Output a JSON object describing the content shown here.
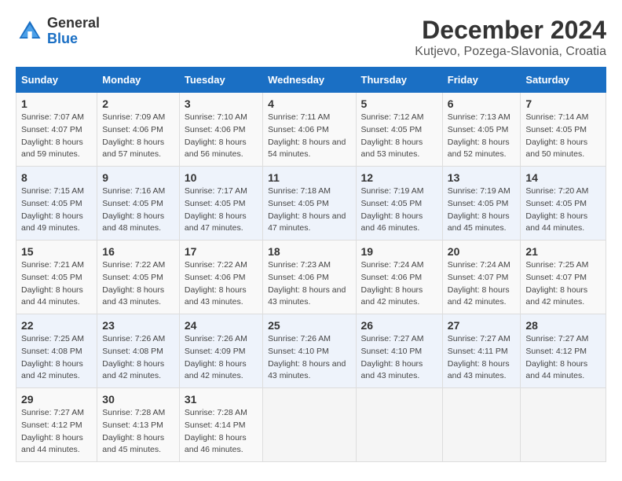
{
  "header": {
    "logo_general": "General",
    "logo_blue": "Blue",
    "month_title": "December 2024",
    "location": "Kutjevo, Pozega-Slavonia, Croatia"
  },
  "days_of_week": [
    "Sunday",
    "Monday",
    "Tuesday",
    "Wednesday",
    "Thursday",
    "Friday",
    "Saturday"
  ],
  "weeks": [
    [
      {
        "day": 1,
        "sunrise": "7:07 AM",
        "sunset": "4:07 PM",
        "daylight": "8 hours and 59 minutes."
      },
      {
        "day": 2,
        "sunrise": "7:09 AM",
        "sunset": "4:06 PM",
        "daylight": "8 hours and 57 minutes."
      },
      {
        "day": 3,
        "sunrise": "7:10 AM",
        "sunset": "4:06 PM",
        "daylight": "8 hours and 56 minutes."
      },
      {
        "day": 4,
        "sunrise": "7:11 AM",
        "sunset": "4:06 PM",
        "daylight": "8 hours and 54 minutes."
      },
      {
        "day": 5,
        "sunrise": "7:12 AM",
        "sunset": "4:05 PM",
        "daylight": "8 hours and 53 minutes."
      },
      {
        "day": 6,
        "sunrise": "7:13 AM",
        "sunset": "4:05 PM",
        "daylight": "8 hours and 52 minutes."
      },
      {
        "day": 7,
        "sunrise": "7:14 AM",
        "sunset": "4:05 PM",
        "daylight": "8 hours and 50 minutes."
      }
    ],
    [
      {
        "day": 8,
        "sunrise": "7:15 AM",
        "sunset": "4:05 PM",
        "daylight": "8 hours and 49 minutes."
      },
      {
        "day": 9,
        "sunrise": "7:16 AM",
        "sunset": "4:05 PM",
        "daylight": "8 hours and 48 minutes."
      },
      {
        "day": 10,
        "sunrise": "7:17 AM",
        "sunset": "4:05 PM",
        "daylight": "8 hours and 47 minutes."
      },
      {
        "day": 11,
        "sunrise": "7:18 AM",
        "sunset": "4:05 PM",
        "daylight": "8 hours and 47 minutes."
      },
      {
        "day": 12,
        "sunrise": "7:19 AM",
        "sunset": "4:05 PM",
        "daylight": "8 hours and 46 minutes."
      },
      {
        "day": 13,
        "sunrise": "7:19 AM",
        "sunset": "4:05 PM",
        "daylight": "8 hours and 45 minutes."
      },
      {
        "day": 14,
        "sunrise": "7:20 AM",
        "sunset": "4:05 PM",
        "daylight": "8 hours and 44 minutes."
      }
    ],
    [
      {
        "day": 15,
        "sunrise": "7:21 AM",
        "sunset": "4:05 PM",
        "daylight": "8 hours and 44 minutes."
      },
      {
        "day": 16,
        "sunrise": "7:22 AM",
        "sunset": "4:05 PM",
        "daylight": "8 hours and 43 minutes."
      },
      {
        "day": 17,
        "sunrise": "7:22 AM",
        "sunset": "4:06 PM",
        "daylight": "8 hours and 43 minutes."
      },
      {
        "day": 18,
        "sunrise": "7:23 AM",
        "sunset": "4:06 PM",
        "daylight": "8 hours and 43 minutes."
      },
      {
        "day": 19,
        "sunrise": "7:24 AM",
        "sunset": "4:06 PM",
        "daylight": "8 hours and 42 minutes."
      },
      {
        "day": 20,
        "sunrise": "7:24 AM",
        "sunset": "4:07 PM",
        "daylight": "8 hours and 42 minutes."
      },
      {
        "day": 21,
        "sunrise": "7:25 AM",
        "sunset": "4:07 PM",
        "daylight": "8 hours and 42 minutes."
      }
    ],
    [
      {
        "day": 22,
        "sunrise": "7:25 AM",
        "sunset": "4:08 PM",
        "daylight": "8 hours and 42 minutes."
      },
      {
        "day": 23,
        "sunrise": "7:26 AM",
        "sunset": "4:08 PM",
        "daylight": "8 hours and 42 minutes."
      },
      {
        "day": 24,
        "sunrise": "7:26 AM",
        "sunset": "4:09 PM",
        "daylight": "8 hours and 42 minutes."
      },
      {
        "day": 25,
        "sunrise": "7:26 AM",
        "sunset": "4:10 PM",
        "daylight": "8 hours and 43 minutes."
      },
      {
        "day": 26,
        "sunrise": "7:27 AM",
        "sunset": "4:10 PM",
        "daylight": "8 hours and 43 minutes."
      },
      {
        "day": 27,
        "sunrise": "7:27 AM",
        "sunset": "4:11 PM",
        "daylight": "8 hours and 43 minutes."
      },
      {
        "day": 28,
        "sunrise": "7:27 AM",
        "sunset": "4:12 PM",
        "daylight": "8 hours and 44 minutes."
      }
    ],
    [
      {
        "day": 29,
        "sunrise": "7:27 AM",
        "sunset": "4:12 PM",
        "daylight": "8 hours and 44 minutes."
      },
      {
        "day": 30,
        "sunrise": "7:28 AM",
        "sunset": "4:13 PM",
        "daylight": "8 hours and 45 minutes."
      },
      {
        "day": 31,
        "sunrise": "7:28 AM",
        "sunset": "4:14 PM",
        "daylight": "8 hours and 46 minutes."
      },
      null,
      null,
      null,
      null
    ]
  ]
}
